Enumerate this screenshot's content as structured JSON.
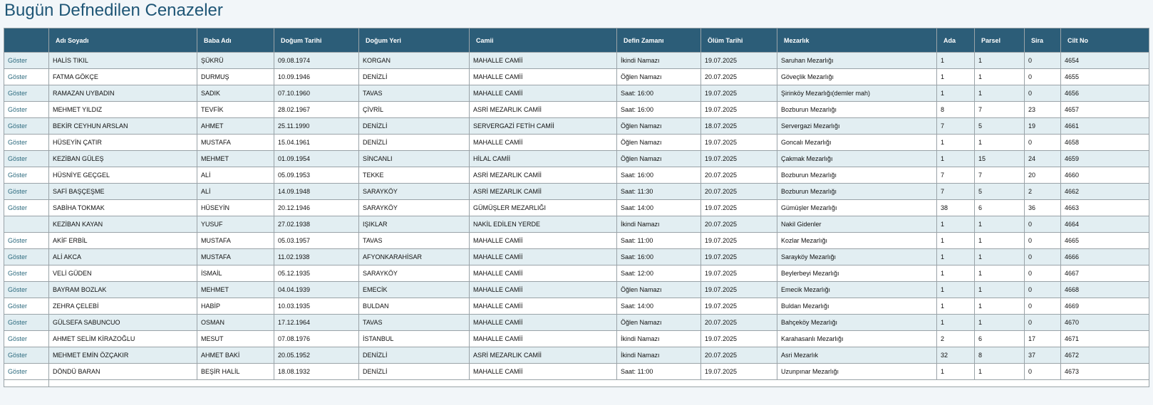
{
  "page": {
    "title": "Bugün Defnedilen Cenazeler"
  },
  "table": {
    "headers": [
      "",
      "Adı Soyadı",
      "Baba Adı",
      "Doğum Tarihi",
      "Doğum Yeri",
      "Camii",
      "Defin Zamanı",
      "Ölüm Tarihi",
      "Mezarlık",
      "Ada",
      "Parsel",
      "Sira",
      "Cilt No"
    ],
    "rows": [
      [
        "Göster",
        "HALİS TIKIL",
        "ŞÜKRÜ",
        "09.08.1974",
        "KORGAN",
        "MAHALLE CAMİİ",
        "İkindi Namazı",
        "19.07.2025",
        "Saruhan Mezarlığı",
        "1",
        "1",
        "0",
        "4654"
      ],
      [
        "Göster",
        "FATMA GÖKÇE",
        "DURMUŞ",
        "10.09.1946",
        "DENİZLİ",
        "MAHALLE CAMİİ",
        "Öğlen Namazı",
        "20.07.2025",
        "Göveçlik Mezarlığı",
        "1",
        "1",
        "0",
        "4655"
      ],
      [
        "Göster",
        "RAMAZAN UYBADIN",
        "SADIK",
        "07.10.1960",
        "TAVAS",
        "MAHALLE CAMİİ",
        "Saat: 16:00",
        "19.07.2025",
        "Şirinköy Mezarlığı(demler mah)",
        "1",
        "1",
        "0",
        "4656"
      ],
      [
        "Göster",
        "MEHMET YILDIZ",
        "TEVFİK",
        "28.02.1967",
        "ÇİVRİL",
        "ASRİ MEZARLIK CAMİİ",
        "Saat: 16:00",
        "19.07.2025",
        "Bozburun Mezarlığı",
        "8",
        "7",
        "23",
        "4657"
      ],
      [
        "Göster",
        "BEKİR CEYHUN ARSLAN",
        "AHMET",
        "25.11.1990",
        "DENİZLİ",
        "SERVERGAZİ FETİH CAMİİ",
        "Öğlen Namazı",
        "18.07.2025",
        "Servergazi Mezarlığı",
        "7",
        "5",
        "19",
        "4661"
      ],
      [
        "Göster",
        "HÜSEYİN ÇATIR",
        "MUSTAFA",
        "15.04.1961",
        "DENİZLİ",
        "MAHALLE CAMİİ",
        "Öğlen Namazı",
        "19.07.2025",
        "Goncalı Mezarlığı",
        "1",
        "1",
        "0",
        "4658"
      ],
      [
        "Göster",
        "KEZİBAN GÜLEŞ",
        "MEHMET",
        "01.09.1954",
        "SİNCANLI",
        "HİLAL CAMİİ",
        "Öğlen Namazı",
        "19.07.2025",
        "Çakmak Mezarlığı",
        "1",
        "15",
        "24",
        "4659"
      ],
      [
        "Göster",
        "HÜSNİYE GEÇGEL",
        "ALİ",
        "05.09.1953",
        "TEKKE",
        "ASRİ MEZARLIK CAMİİ",
        "Saat: 16:00",
        "20.07.2025",
        "Bozburun Mezarlığı",
        "7",
        "7",
        "20",
        "4660"
      ],
      [
        "Göster",
        "SAFİ BAŞÇEŞME",
        "ALİ",
        "14.09.1948",
        "SARAYKÖY",
        "ASRİ MEZARLIK CAMİİ",
        "Saat: 11:30",
        "20.07.2025",
        "Bozburun Mezarlığı",
        "7",
        "5",
        "2",
        "4662"
      ],
      [
        "Göster",
        "SABİHA TOKMAK",
        "HÜSEYİN",
        "20.12.1946",
        "SARAYKÖY",
        "GÜMÜŞLER MEZARLIĞI",
        "Saat: 14:00",
        "19.07.2025",
        "Gümüşler Mezarlığı",
        "38",
        "6",
        "36",
        "4663"
      ],
      [
        "",
        "KEZİBAN KAYAN",
        "YUSUF",
        "27.02.1938",
        "IŞIKLAR",
        "NAKİL EDİLEN YERDE",
        "İkindi Namazı",
        "20.07.2025",
        "Nakil Gidenler",
        "1",
        "1",
        "0",
        "4664"
      ],
      [
        "Göster",
        "AKİF ERBİL",
        "MUSTAFA",
        "05.03.1957",
        "TAVAS",
        "MAHALLE CAMİİ",
        "Saat: 11:00",
        "19.07.2025",
        "Kozlar Mezarlığı",
        "1",
        "1",
        "0",
        "4665"
      ],
      [
        "Göster",
        "ALİ AKCA",
        "MUSTAFA",
        "11.02.1938",
        "AFYONKARAHİSAR",
        "MAHALLE CAMİİ",
        "Saat: 16:00",
        "19.07.2025",
        "Sarayköy Mezarlığı",
        "1",
        "1",
        "0",
        "4666"
      ],
      [
        "Göster",
        "VELİ GÜDEN",
        "İSMAİL",
        "05.12.1935",
        "SARAYKÖY",
        "MAHALLE CAMİİ",
        "Saat: 12:00",
        "19.07.2025",
        "Beylerbeyi Mezarlığı",
        "1",
        "1",
        "0",
        "4667"
      ],
      [
        "Göster",
        "BAYRAM BOZLAK",
        "MEHMET",
        "04.04.1939",
        "EMECİK",
        "MAHALLE CAMİİ",
        "Öğlen Namazı",
        "19.07.2025",
        "Emecik Mezarlığı",
        "1",
        "1",
        "0",
        "4668"
      ],
      [
        "Göster",
        "ZEHRA ÇELEBİ",
        "HABİP",
        "10.03.1935",
        "BULDAN",
        "MAHALLE CAMİİ",
        "Saat: 14:00",
        "19.07.2025",
        "Buldan Mezarlığı",
        "1",
        "1",
        "0",
        "4669"
      ],
      [
        "Göster",
        "GÜLSEFA SABUNCUO",
        "OSMAN",
        "17.12.1964",
        "TAVAS",
        "MAHALLE CAMİİ",
        "Öğlen Namazı",
        "20.07.2025",
        "Bahçeköy Mezarlığı",
        "1",
        "1",
        "0",
        "4670"
      ],
      [
        "Göster",
        "AHMET SELİM KİRAZOĞLU",
        "MESUT",
        "07.08.1976",
        "İSTANBUL",
        "MAHALLE CAMİİ",
        "İkindi Namazı",
        "19.07.2025",
        "Karahasanlı Mezarlığı",
        "2",
        "6",
        "17",
        "4671"
      ],
      [
        "Göster",
        "MEHMET EMİN ÖZÇAKIR",
        "AHMET BAKİ",
        "20.05.1952",
        "DENİZLİ",
        "ASRİ MEZARLIK CAMİİ",
        "İkindi Namazı",
        "20.07.2025",
        "Asri Mezarlık",
        "32",
        "8",
        "37",
        "4672"
      ],
      [
        "Göster",
        "DÖNDÜ BARAN",
        "BEŞİR HALİL",
        "18.08.1932",
        "DENİZLİ",
        "MAHALLE CAMİİ",
        "Saat: 11:00",
        "19.07.2025",
        "Uzunpınar Mezarlığı",
        "1",
        "1",
        "0",
        "4673"
      ]
    ]
  },
  "colors": {
    "title": "#1f5676",
    "header_bg": "#2c5d78",
    "row_alt": "#e2eef2",
    "link": "#2c6a7e"
  }
}
